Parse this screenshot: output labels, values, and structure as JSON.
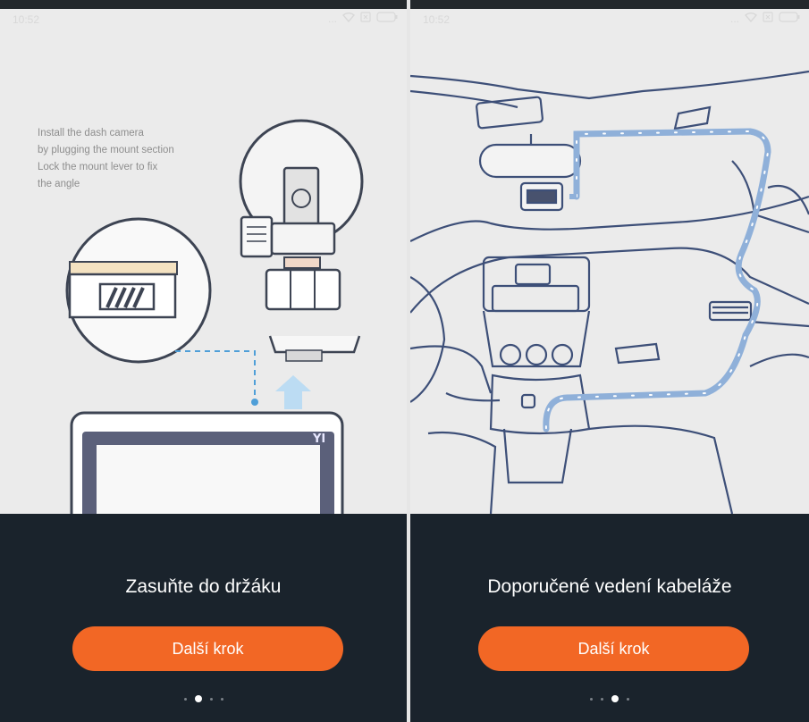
{
  "screens": [
    {
      "status": {
        "time": "10:52",
        "dots": "..."
      },
      "instruction_lines": [
        "Install the dash camera",
        "by plugging the mount section",
        "Lock the mount lever to fix",
        "the angle"
      ],
      "camera_brand": "YI",
      "title": "Zasuňte do držáku",
      "button_label": "Další krok",
      "pagination": {
        "total": 4,
        "active_index": 1
      }
    },
    {
      "status": {
        "time": "10:52",
        "dots": "..."
      },
      "title": "Doporučené vedení kabeláže",
      "button_label": "Další krok",
      "pagination": {
        "total": 4,
        "active_index": 2
      }
    }
  ],
  "colors": {
    "accent": "#f26725",
    "background": "#1a232c",
    "illustration_bg": "#ebebeb",
    "cable": "#8fb0d9"
  }
}
